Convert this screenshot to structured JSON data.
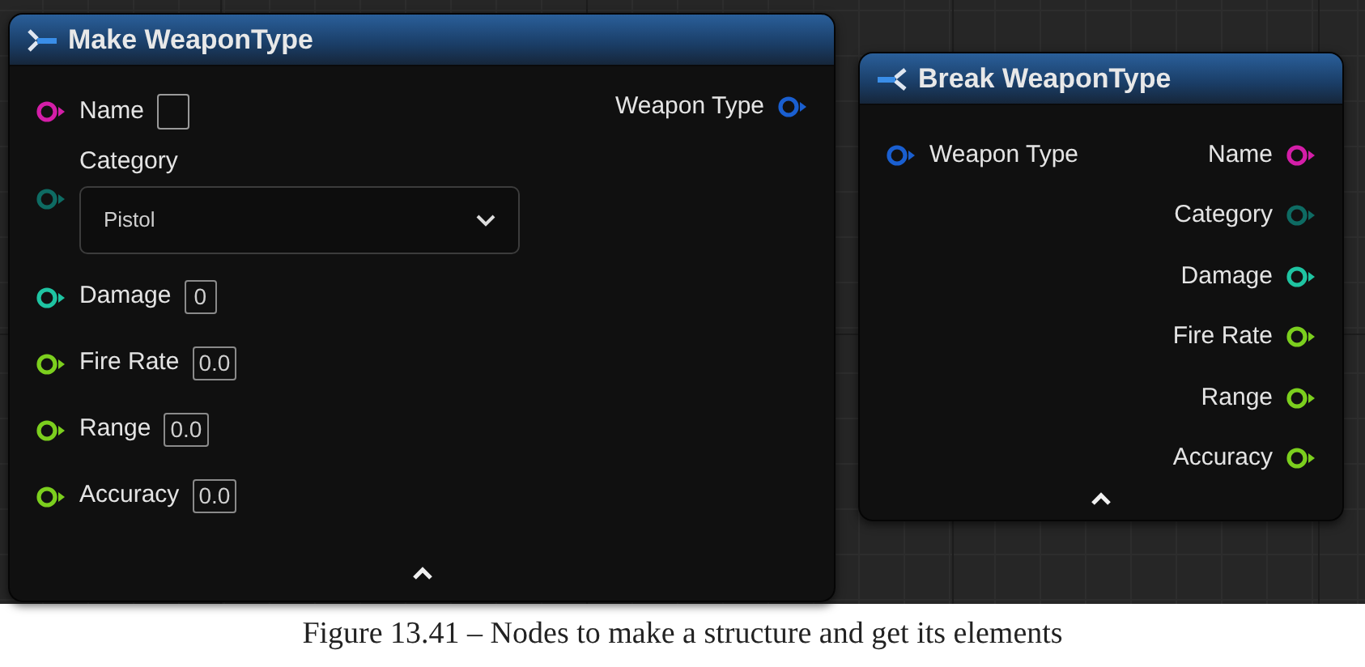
{
  "make_node": {
    "title": "Make WeaponType",
    "inputs": [
      {
        "label": "Name",
        "color": "#d41ea8",
        "kind": "checkbox",
        "checked": false
      },
      {
        "label": "Category",
        "color": "#0e6b63",
        "kind": "dropdown",
        "value": "Pistol"
      },
      {
        "label": "Damage",
        "color": "#1fc4a2",
        "kind": "number",
        "value": "0"
      },
      {
        "label": "Fire Rate",
        "color": "#7ccf1e",
        "kind": "number",
        "value": "0.0"
      },
      {
        "label": "Range",
        "color": "#7ccf1e",
        "kind": "number",
        "value": "0.0"
      },
      {
        "label": "Accuracy",
        "color": "#7ccf1e",
        "kind": "number",
        "value": "0.0"
      }
    ],
    "output": {
      "label": "Weapon Type",
      "color": "#1a5fd0"
    }
  },
  "break_node": {
    "title": "Break WeaponType",
    "input": {
      "label": "Weapon Type",
      "color": "#1a5fd0"
    },
    "outputs": [
      {
        "label": "Name",
        "color": "#d41ea8"
      },
      {
        "label": "Category",
        "color": "#0e6b63"
      },
      {
        "label": "Damage",
        "color": "#1fc4a2"
      },
      {
        "label": "Fire Rate",
        "color": "#7ccf1e"
      },
      {
        "label": "Range",
        "color": "#7ccf1e"
      },
      {
        "label": "Accuracy",
        "color": "#7ccf1e"
      }
    ]
  },
  "caption": "Figure 13.41 – Nodes to make a structure and get its elements"
}
